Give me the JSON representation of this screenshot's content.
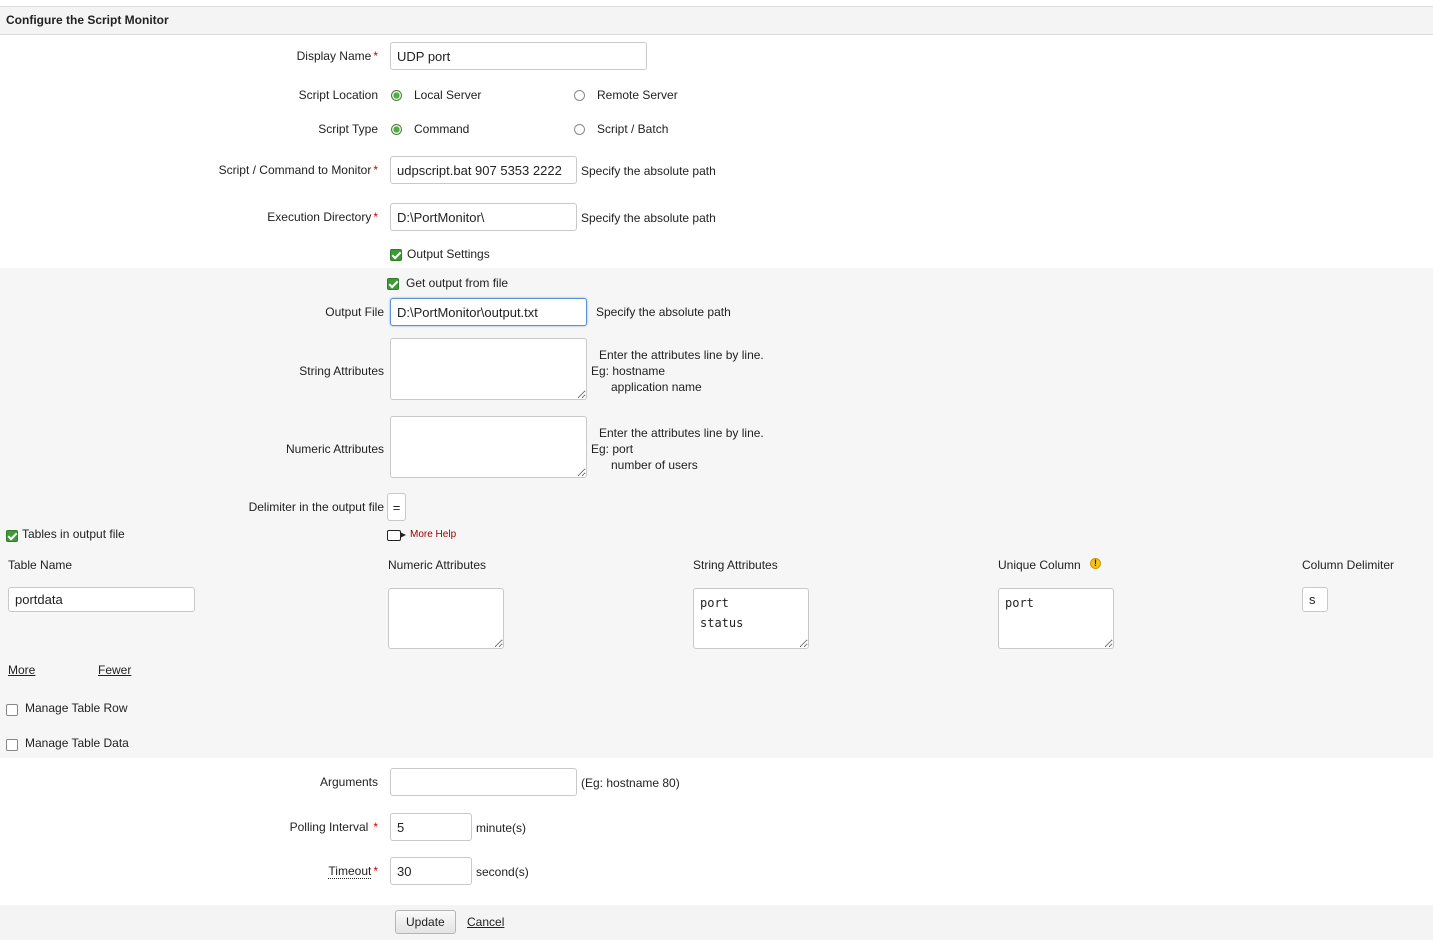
{
  "header": {
    "title": "Configure the Script Monitor"
  },
  "form": {
    "display_name": {
      "label": "Display Name",
      "value": "UDP port"
    },
    "script_location": {
      "label": "Script Location",
      "options": [
        "Local Server",
        "Remote Server"
      ],
      "selected": "Local Server"
    },
    "script_type": {
      "label": "Script Type",
      "options": [
        "Command",
        "Script / Batch"
      ],
      "selected": "Command"
    },
    "script_command": {
      "label": "Script / Command to Monitor",
      "value": "udpscript.bat 907 5353 2222",
      "hint": "Specify the absolute path"
    },
    "execution_directory": {
      "label": "Execution Directory",
      "value": "D:\\PortMonitor\\",
      "hint": "Specify the absolute path"
    },
    "output_settings": {
      "label": "Output Settings",
      "checked": true
    },
    "get_output_from_file": {
      "label": "Get output from file",
      "checked": true
    },
    "output_file": {
      "label": "Output File",
      "value": "D:\\PortMonitor\\output.txt",
      "hint": "Specify the absolute path"
    },
    "string_attributes": {
      "label": "String Attributes",
      "value": "",
      "hint_line1": "Enter the attributes line by line.",
      "hint_line2": "Eg: hostname",
      "hint_line3": "application name"
    },
    "numeric_attributes": {
      "label": "Numeric Attributes",
      "value": "",
      "hint_line1": "Enter the attributes line by line.",
      "hint_line2": "Eg: port",
      "hint_line3": "number of users"
    },
    "delimiter": {
      "label": "Delimiter in the output file",
      "value": "="
    },
    "tables_in_output_file": {
      "label": "Tables in output file",
      "checked": true
    },
    "more_help": "More Help",
    "table": {
      "headers": [
        "Table Name",
        "Numeric Attributes",
        "String Attributes",
        "Unique Column",
        "Column Delimiter"
      ],
      "row": {
        "table_name": "portdata",
        "numeric_attributes": "",
        "string_attributes": "port\nstatus",
        "unique_column": "port",
        "column_delimiter": "s"
      }
    },
    "more_link": "More",
    "fewer_link": "Fewer",
    "manage_table_row": {
      "label": "Manage Table Row",
      "checked": false
    },
    "manage_table_data": {
      "label": "Manage Table Data",
      "checked": false
    },
    "arguments": {
      "label": "Arguments",
      "value": "",
      "hint": "(Eg: hostname 80)"
    },
    "polling_interval": {
      "label": "Polling Interval",
      "value": "5",
      "unit": "minute(s)"
    },
    "timeout": {
      "label": "Timeout",
      "value": "30",
      "unit": "second(s)"
    }
  },
  "actions": {
    "update": "Update",
    "cancel": "Cancel"
  },
  "colors": {
    "required": "#cc0000",
    "check_green": "#3f9b37",
    "link_red": "#990000",
    "focus_border": "#5b8fd6"
  }
}
